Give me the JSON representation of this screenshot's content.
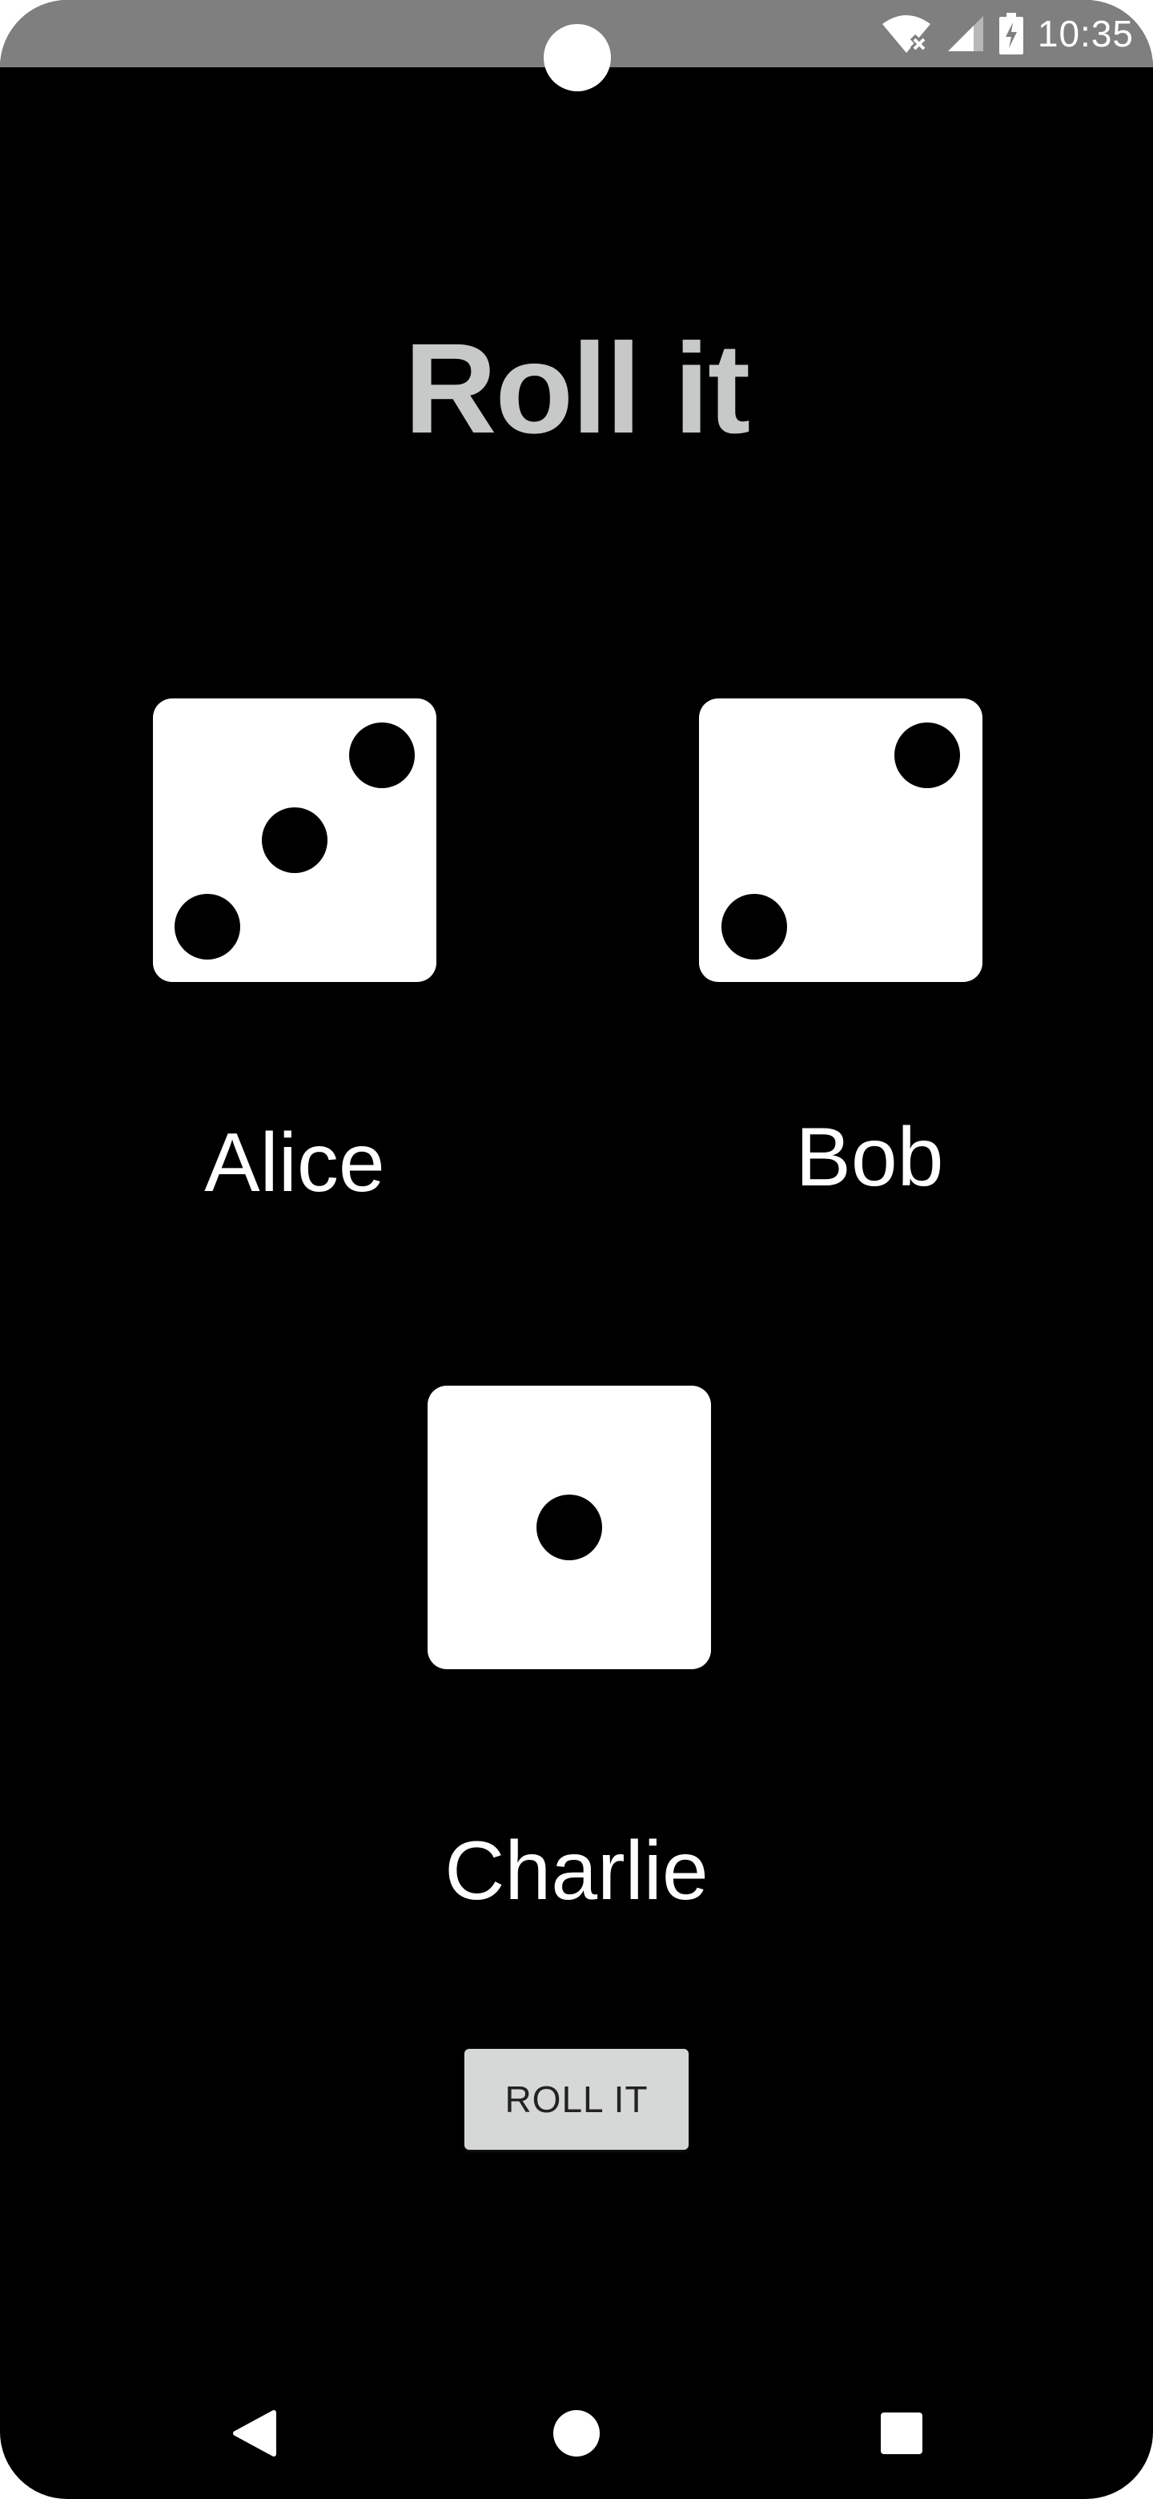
{
  "status_bar": {
    "time": "10:35",
    "icons": [
      "wifi-off-icon",
      "signal-icon",
      "battery-charging-icon"
    ]
  },
  "app": {
    "title": "Roll it"
  },
  "players": [
    {
      "name": "Alice",
      "die_value": 3
    },
    {
      "name": "Bob",
      "die_value": 2
    },
    {
      "name": "Charlie",
      "die_value": 1
    }
  ],
  "roll_button": {
    "label": "ROLL IT"
  },
  "nav_bar": {
    "buttons": [
      "back-icon",
      "home-icon",
      "recents-icon"
    ]
  },
  "colors": {
    "background": "#000000",
    "status_bar": "#7f7f7f",
    "title": "#c6c9c8",
    "die_face": "#ffffff",
    "pip": "#000000",
    "button": "#d6d7d7"
  }
}
